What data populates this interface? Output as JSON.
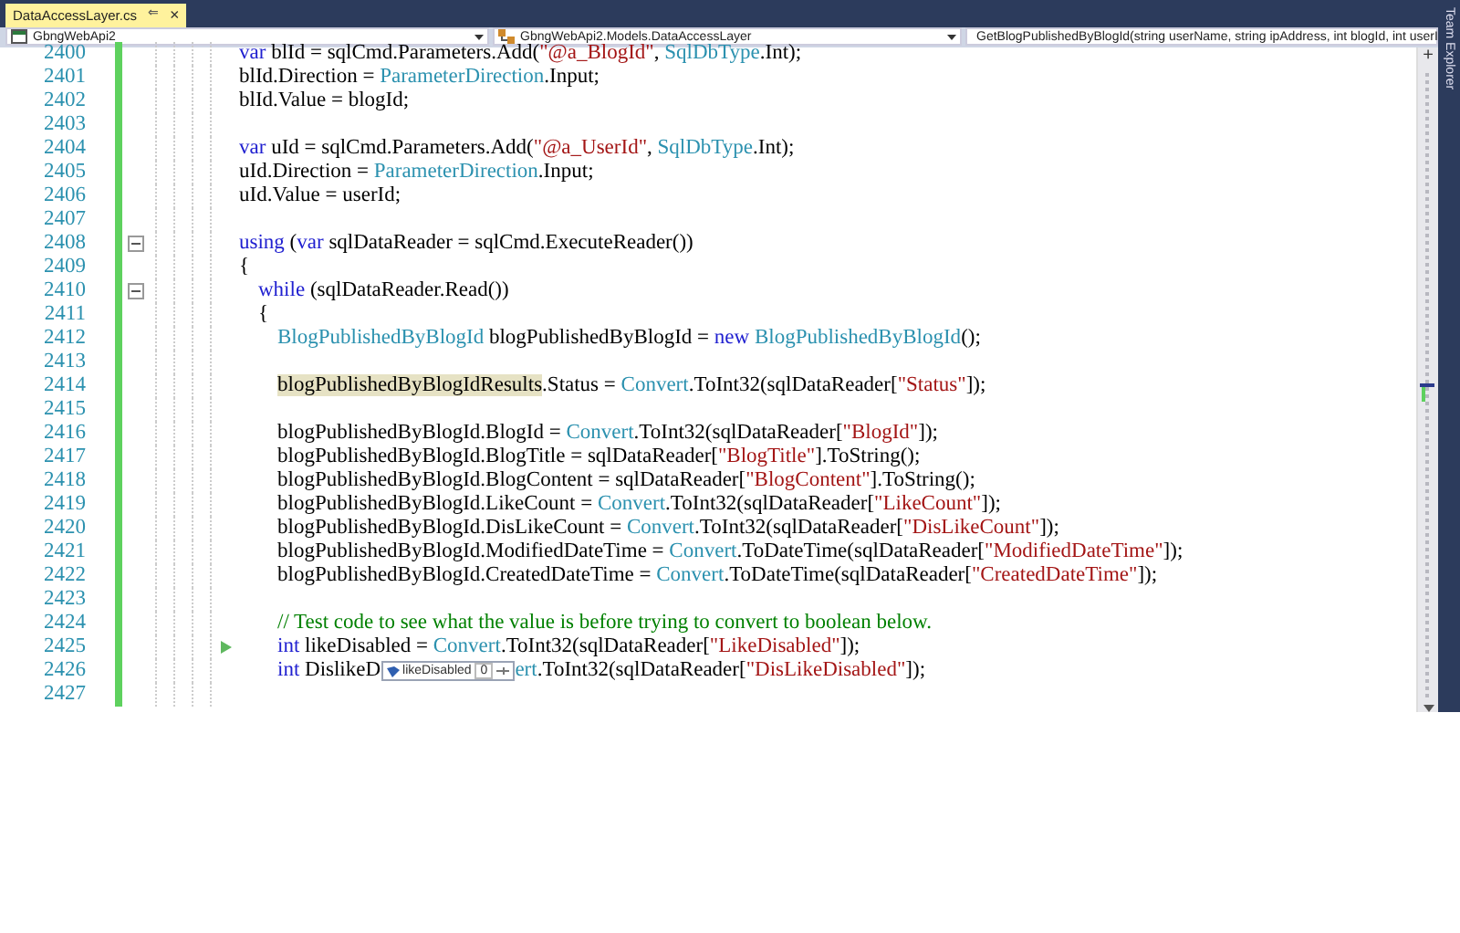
{
  "tab": {
    "title": "DataAccessLayer.cs",
    "pin": "⇐",
    "close": "×"
  },
  "nav": [
    {
      "kind": "project",
      "text": "GbngWebApi2"
    },
    {
      "kind": "class",
      "text": "GbngWebApi2.Models.DataAccessLayer"
    },
    {
      "kind": "method",
      "text": "GetBlogPublishedByBlogId(string userName, string ipAddress, int blogId, int userI"
    }
  ],
  "scrollbar": {
    "split": "+"
  },
  "side_tab": "Team Explorer",
  "lines": [
    {
      "number": "2400",
      "fold": false,
      "marker": false,
      "tokens": [
        {
          "kind": "keyword",
          "text": "var"
        },
        {
          "kind": "plain",
          "text": " blId = sqlCmd.Parameters.Add("
        },
        {
          "kind": "string",
          "text": "\"@a_BlogId\""
        },
        {
          "kind": "plain",
          "text": ", "
        },
        {
          "kind": "type",
          "text": "SqlDbType"
        },
        {
          "kind": "plain",
          "text": ".Int);"
        }
      ]
    },
    {
      "number": "2401",
      "fold": false,
      "marker": false,
      "tokens": [
        {
          "kind": "plain",
          "text": "blId.Direction = "
        },
        {
          "kind": "type",
          "text": "ParameterDirection"
        },
        {
          "kind": "plain",
          "text": ".Input;"
        }
      ]
    },
    {
      "number": "2402",
      "fold": false,
      "marker": false,
      "tokens": [
        {
          "kind": "plain",
          "text": "blId.Value = blogId;"
        }
      ]
    },
    {
      "number": "2403",
      "fold": false,
      "marker": false
    },
    {
      "number": "2404",
      "fold": false,
      "marker": false,
      "tokens": [
        {
          "kind": "keyword",
          "text": "var"
        },
        {
          "kind": "plain",
          "text": " uId = sqlCmd.Parameters.Add("
        },
        {
          "kind": "string",
          "text": "\"@a_UserId\""
        },
        {
          "kind": "plain",
          "text": ", "
        },
        {
          "kind": "type",
          "text": "SqlDbType"
        },
        {
          "kind": "plain",
          "text": ".Int);"
        }
      ]
    },
    {
      "number": "2405",
      "fold": false,
      "marker": false,
      "tokens": [
        {
          "kind": "plain",
          "text": "uId.Direction = "
        },
        {
          "kind": "type",
          "text": "ParameterDirection"
        },
        {
          "kind": "plain",
          "text": ".Input;"
        }
      ]
    },
    {
      "number": "2406",
      "fold": false,
      "marker": false,
      "tokens": [
        {
          "kind": "plain",
          "text": "uId.Value = userId;"
        }
      ]
    },
    {
      "number": "2407",
      "fold": false,
      "marker": false
    },
    {
      "number": "2408",
      "fold": true,
      "marker": false,
      "tokens": [
        {
          "kind": "keyword",
          "text": "using"
        },
        {
          "kind": "plain",
          "text": " ("
        },
        {
          "kind": "keyword",
          "text": "var"
        },
        {
          "kind": "plain",
          "text": " sqlDataReader = sqlCmd.ExecuteReader())"
        }
      ]
    },
    {
      "number": "2409",
      "fold": false,
      "marker": false,
      "tokens": [
        {
          "kind": "plain",
          "text": "{"
        }
      ],
      "children": [
        {
          "number": "2410",
          "fold": true,
          "marker": false,
          "tokens": [
            {
              "kind": "keyword",
              "text": "while"
            },
            {
              "kind": "plain",
              "text": " (sqlDataReader.Read())"
            }
          ]
        },
        {
          "number": "2411",
          "fold": false,
          "marker": false,
          "tokens": [
            {
              "kind": "plain",
              "text": "{"
            }
          ],
          "children": [
            {
              "number": "2412",
              "fold": false,
              "marker": false,
              "tokens": [
                {
                  "kind": "type",
                  "text": "BlogPublishedByBlogId"
                },
                {
                  "kind": "plain",
                  "text": " blogPublishedByBlogId = "
                },
                {
                  "kind": "keyword",
                  "text": "new"
                },
                {
                  "kind": "type",
                  "text": " BlogPublishedByBlogId"
                },
                {
                  "kind": "plain",
                  "text": "();"
                }
              ]
            },
            {
              "number": "2413",
              "fold": false,
              "marker": false
            },
            {
              "number": "2414",
              "fold": false,
              "marker": false,
              "tokens": [
                {
                  "kind": "reference",
                  "text": "blogPublishedByBlogIdResults"
                },
                {
                  "kind": "plain",
                  "text": ".Status = "
                },
                {
                  "kind": "type",
                  "text": "Convert"
                },
                {
                  "kind": "plain",
                  "text": ".ToInt32(sqlDataReader["
                },
                {
                  "kind": "string",
                  "text": "\"Status\""
                },
                {
                  "kind": "plain",
                  "text": "]);"
                }
              ]
            },
            {
              "number": "2415",
              "fold": false,
              "marker": false
            },
            {
              "number": "2416",
              "fold": false,
              "marker": false,
              "tokens": [
                {
                  "kind": "plain",
                  "text": "blogPublishedByBlogId.BlogId = "
                },
                {
                  "kind": "type",
                  "text": "Convert"
                },
                {
                  "kind": "plain",
                  "text": ".ToInt32(sqlDataReader["
                },
                {
                  "kind": "string",
                  "text": "\"BlogId\""
                },
                {
                  "kind": "plain",
                  "text": "]);"
                }
              ]
            },
            {
              "number": "2417",
              "fold": false,
              "marker": false,
              "tokens": [
                {
                  "kind": "plain",
                  "text": "blogPublishedByBlogId.BlogTitle = sqlDataReader["
                },
                {
                  "kind": "string",
                  "text": "\"BlogTitle\""
                },
                {
                  "kind": "plain",
                  "text": "].ToString();"
                }
              ]
            },
            {
              "number": "2418",
              "fold": false,
              "marker": false,
              "tokens": [
                {
                  "kind": "plain",
                  "text": "blogPublishedByBlogId.BlogContent = sqlDataReader["
                },
                {
                  "kind": "string",
                  "text": "\"BlogContent\""
                },
                {
                  "kind": "plain",
                  "text": "].ToString();"
                }
              ]
            },
            {
              "number": "2419",
              "fold": false,
              "marker": false,
              "tokens": [
                {
                  "kind": "plain",
                  "text": "blogPublishedByBlogId.LikeCount = "
                },
                {
                  "kind": "type",
                  "text": "Convert"
                },
                {
                  "kind": "plain",
                  "text": ".ToInt32(sqlDataReader["
                },
                {
                  "kind": "string",
                  "text": "\"LikeCount\""
                },
                {
                  "kind": "plain",
                  "text": "]);"
                }
              ]
            },
            {
              "number": "2420",
              "fold": false,
              "marker": false,
              "tokens": [
                {
                  "kind": "plain",
                  "text": "blogPublishedByBlogId.DisLikeCount = "
                },
                {
                  "kind": "type",
                  "text": "Convert"
                },
                {
                  "kind": "plain",
                  "text": ".ToInt32(sqlDataReader["
                },
                {
                  "kind": "string",
                  "text": "\"DisLikeCount\""
                },
                {
                  "kind": "plain",
                  "text": "]);"
                }
              ]
            },
            {
              "number": "2421",
              "fold": false,
              "marker": false,
              "tokens": [
                {
                  "kind": "plain",
                  "text": "blogPublishedByBlogId.ModifiedDateTime = "
                },
                {
                  "kind": "type",
                  "text": "Convert"
                },
                {
                  "kind": "plain",
                  "text": ".ToDateTime(sqlDataReader["
                },
                {
                  "kind": "string",
                  "text": "\"ModifiedDateTime\""
                },
                {
                  "kind": "plain",
                  "text": "]);"
                }
              ]
            },
            {
              "number": "2422",
              "fold": false,
              "marker": false,
              "tokens": [
                {
                  "kind": "plain",
                  "text": "blogPublishedByBlogId.CreatedDateTime = "
                },
                {
                  "kind": "type",
                  "text": "Convert"
                },
                {
                  "kind": "plain",
                  "text": ".ToDateTime(sqlDataReader["
                },
                {
                  "kind": "string",
                  "text": "\"CreatedDateTime\""
                },
                {
                  "kind": "plain",
                  "text": "]);"
                }
              ]
            },
            {
              "number": "2423",
              "fold": false,
              "marker": false
            },
            {
              "number": "2424",
              "fold": false,
              "marker": false,
              "tokens": [
                {
                  "kind": "comment",
                  "text": "// Test code to see what the value is before trying to convert to boolean below."
                }
              ]
            },
            {
              "number": "2425",
              "fold": false,
              "marker": true,
              "tokens": [
                {
                  "kind": "keyword",
                  "text": "int"
                },
                {
                  "kind": "plain",
                  "text": " likeDisabled = "
                },
                {
                  "kind": "type",
                  "text": "Convert"
                },
                {
                  "kind": "plain",
                  "text": ".ToInt32(sqlDataReader["
                },
                {
                  "kind": "string",
                  "text": "\"LikeDisabled\""
                },
                {
                  "kind": "plain",
                  "text": "]);"
                }
              ]
            },
            {
              "number": "2426",
              "fold": false,
              "marker": false,
              "tokens": [
                {
                  "kind": "keyword",
                  "text": "int"
                },
                {
                  "kind": "plain",
                  "text": " DislikeD"
                },
                {
                  "kind": "datatip",
                  "name": "likeDisabled",
                  "value": "0"
                },
                {
                  "kind": "type",
                  "text": "ert"
                },
                {
                  "kind": "plain",
                  "text": ".ToInt32(sqlDataReader["
                },
                {
                  "kind": "string",
                  "text": "\"DisLikeDisabled\""
                },
                {
                  "kind": "plain",
                  "text": "]);"
                }
              ]
            },
            {
              "number": "2427",
              "fold": false,
              "marker": false
            }
          ]
        }
      ]
    }
  ]
}
